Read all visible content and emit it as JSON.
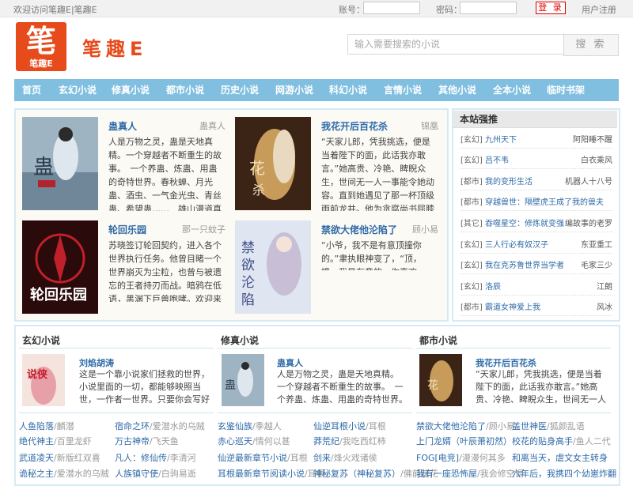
{
  "topbar": {
    "welcome": "欢迎访问笔趣E|笔趣E",
    "account_label": "账号：",
    "password_label": "密码：",
    "login_label": "登 录",
    "register_label": "用户注册"
  },
  "header": {
    "logo_char": "笔",
    "logo_sub": "笔趣E",
    "site_name": "笔趣E"
  },
  "search": {
    "placeholder": "输入需要搜索的小说",
    "button_label": "搜 索"
  },
  "nav": [
    "首页",
    "玄幻小说",
    "修真小说",
    "都市小说",
    "历史小说",
    "网游小说",
    "科幻小说",
    "言情小说",
    "其他小说",
    "全本小说",
    "临时书架"
  ],
  "featured": [
    {
      "title": "蛊真人",
      "author": "蛊真人",
      "desc": "人是万物之灵，蛊是天地真精。一个穿越者不断重生的故事。　一个养蛊、炼蛊、用蛊的奇特世界。春秋蝉、月光蛊、酒虫、一气金光虫、青丝蛊、希望蛊……　雄山漫道真如铁，如今迈步从头越。"
    },
    {
      "title": "我花开后百花杀",
      "author": "锦凰",
      "desc": "“天家儿郎，凭我挑选，便是当着陛下的面，此话我亦敢言。”她高贵、冷艳、睥睨众生，世间无一人一事能令她动容。直到她遇见了那一杯顶级雨前龙井。他为贪腐尚书屈膝求情：“罪不祸及妻儿。”百官感"
    },
    {
      "title": "轮回乐园",
      "author": "那一只蚊子",
      "desc": "苏晓签订轮回契约，进入各个世界执行任务。他曾目睹一个世界崩灭为尘粒，也曾与被遗忘的王者持刃而战。暗鸦在低语，黑渊下巨兽咆哮。欢迎来到，轮回乐园……"
    },
    {
      "title": "禁欲大佬他沦陷了",
      "author": "顾小易",
      "desc": "“小爷，我不是有意顶撞你的。”聿执眼神变了，“顶，撞，我是有意的，你喜欢吗？”"
    }
  ],
  "recommend": {
    "title": "本站强推",
    "items": [
      {
        "cat": "[玄幻]",
        "book": "九州天下",
        "author": "阿阳睡不醒"
      },
      {
        "cat": "[玄幻]",
        "book": "吕不韦",
        "author": "白衣乘风"
      },
      {
        "cat": "[都市]",
        "book": "我的变形生活",
        "author": "机器人十八号"
      },
      {
        "cat": "[都市]",
        "book": "穿越兽世：隔壁虎王成了我的兽夫",
        "author": ""
      },
      {
        "cat": "[其它]",
        "book": "吞噬星空：修炼就变强",
        "author": "编故事的老罗"
      },
      {
        "cat": "[玄幻]",
        "book": "三人行必有奴汉子",
        "author": "东亚重工"
      },
      {
        "cat": "[玄幻]",
        "book": "我在克苏鲁世界当学者",
        "author": "毛家三少"
      },
      {
        "cat": "[玄幻]",
        "book": "洛辰",
        "author": "江朗"
      },
      {
        "cat": "[都市]",
        "book": "霸道女神爱上我",
        "author": "风冰"
      }
    ]
  },
  "categories": [
    {
      "title": "玄幻小说",
      "book": "刘焰胡涛",
      "desc": "这是一个靠小说家们拯救的世界，小说里面的一切，都能够映照当世，一作者一世界。只要你会写好看的小说，你就是横断"
    },
    {
      "title": "修真小说",
      "book": "蛊真人",
      "desc": "人是万物之灵，蛊是天地真精。　一个穿越者不断重生的故事。　一个养蛊、炼蛊、用蛊的奇特世界。"
    },
    {
      "title": "都市小说",
      "book": "我花开后百花杀",
      "desc": "“天家儿郎，凭我挑选，便是当着陛下的面，此话我亦敢言。”她高贵、冷艳、睥睨众生，世间无一人一事能令她动容。直到"
    }
  ],
  "lists": {
    "col1": [
      {
        "name": "人鱼陷落",
        "author": "/麟潜"
      },
      {
        "name": "宿命之环",
        "author": "/爱潜水的乌贼"
      },
      {
        "name": "绝代神主",
        "author": "/百里龙虾"
      },
      {
        "name": "万古神帝",
        "author": "/飞天鱼"
      },
      {
        "name": "武道凌天",
        "author": "/新版红双喜"
      },
      {
        "name": "凡人：修仙传",
        "author": "/李清河"
      },
      {
        "name": "诡秘之主",
        "author": "/爱潜水的乌贼"
      },
      {
        "name": "人族镇守使",
        "author": "/白驹易逝"
      }
    ],
    "col2": [
      {
        "name": "玄鉴仙族",
        "author": "/季越人"
      },
      {
        "name": "仙逆耳根小说",
        "author": "/耳根"
      },
      {
        "name": "赤心巡天",
        "author": "/情何以甚"
      },
      {
        "name": "莽荒纪",
        "author": "/我吃西红柿"
      },
      {
        "name": "仙逆最新章节小说",
        "author": "/耳根"
      },
      {
        "name": "剑来",
        "author": "/烽火戏诸侯"
      },
      {
        "name": "耳根最新章节阅读小说",
        "author": "/耳根"
      },
      {
        "name": "神秘复苏（神秘复苏）",
        "author": "/佛前献花"
      }
    ],
    "col3": [
      {
        "name": "禁欲大佬他沦陷了",
        "author": "/顾小易"
      },
      {
        "name": "盖世神医",
        "author": "/狐颜乱语"
      },
      {
        "name": "上门龙婿（叶辰萧初然）",
        "author": ""
      },
      {
        "name": "校花的贴身高手",
        "author": "/鱼人二代"
      },
      {
        "name": "FOG[电竞]",
        "author": "/漫漫何其多"
      },
      {
        "name": "和离当天，虐文女主转身",
        "author": ""
      },
      {
        "name": "我有一座恐怖屋",
        "author": "/我会修空调"
      },
      {
        "name": "六年后，我携四个幼崽炸翻",
        "author": ""
      }
    ]
  },
  "colors": {
    "brand": "#e74a1b",
    "nav": "#80bfe0",
    "link": "#2e6aa7"
  }
}
